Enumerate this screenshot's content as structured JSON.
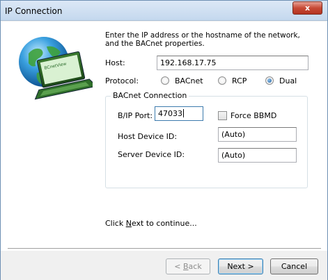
{
  "window": {
    "title": "IP Connection",
    "close_glyph": "x"
  },
  "intro": "Enter the IP address or the hostname of the network, and the BACnet properties.",
  "host": {
    "label": "Host:",
    "value": "192.168.17.75"
  },
  "protocol": {
    "label": "Protocol:",
    "options": [
      "BACnet",
      "RCP",
      "Dual"
    ],
    "selected": "Dual"
  },
  "bacnet": {
    "group_title": "BACnet Connection",
    "port_label": "B/IP Port:",
    "port_value": "47033",
    "force_bbmd_label": "Force BBMD",
    "force_bbmd_checked": false,
    "host_device_label": "Host Device ID:",
    "host_device_value": "(Auto)",
    "server_device_label": "Server Device ID:",
    "server_device_value": "(Auto)"
  },
  "footer": {
    "click_prefix": "Click ",
    "click_next": "N",
    "click_rest": "ext",
    "click_suffix": " to continue..."
  },
  "buttons": {
    "back_prefix": "< ",
    "back_mnemonic": "B",
    "back_rest": "ack",
    "next": "Next >",
    "cancel": "Cancel"
  },
  "logo_text": "BCnetView"
}
